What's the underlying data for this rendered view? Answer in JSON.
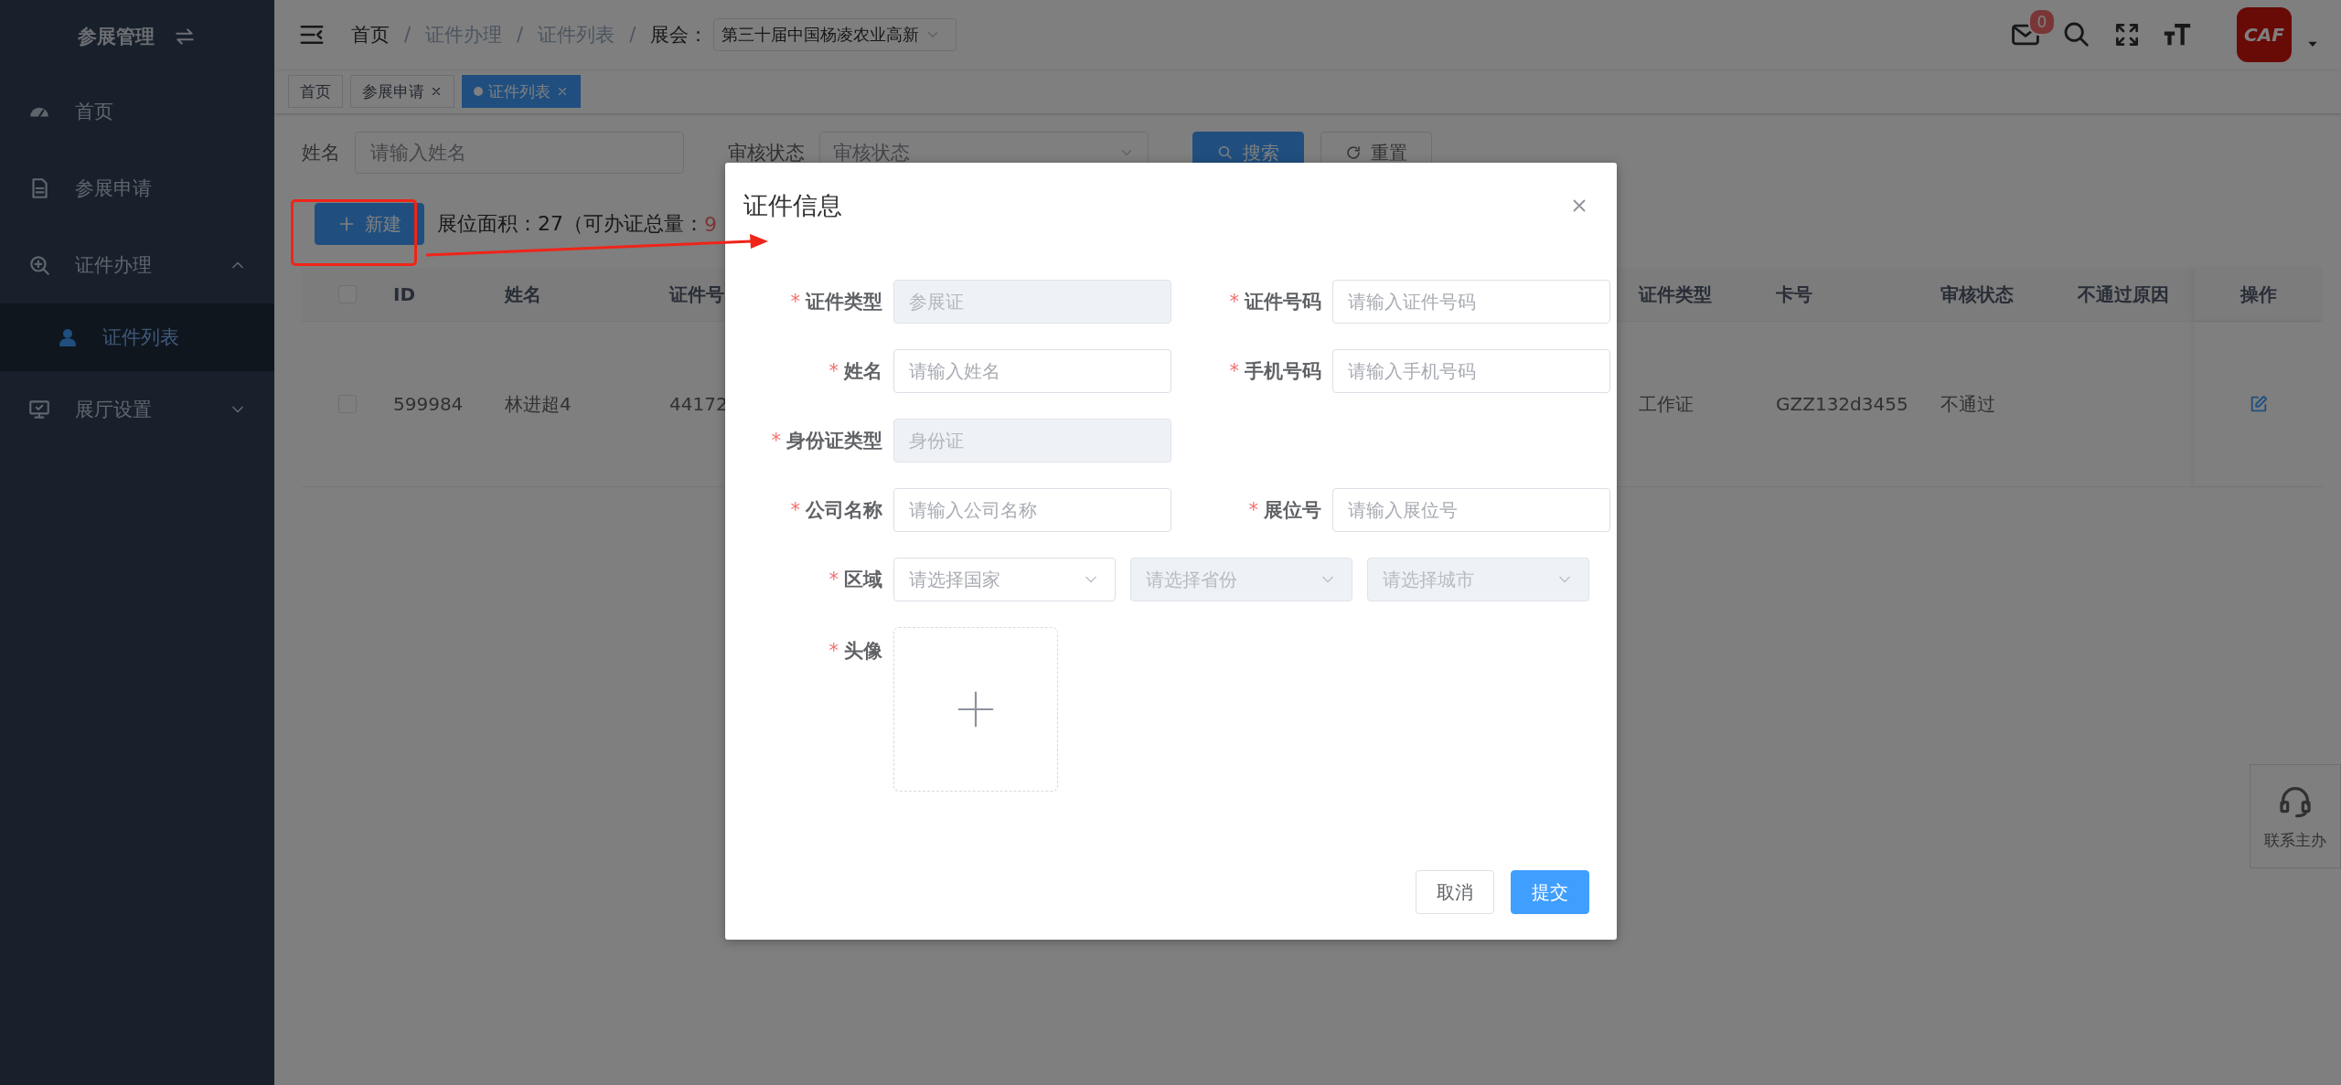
{
  "sidebar": {
    "title": "参展管理",
    "items": [
      {
        "label": "首页",
        "selected": false
      },
      {
        "label": "参展申请",
        "selected": false
      },
      {
        "label": "证件办理",
        "selected": false,
        "expanded": true,
        "children": [
          {
            "label": "证件列表",
            "selected": true
          }
        ]
      },
      {
        "label": "展厅设置",
        "selected": false,
        "expanded": false
      }
    ]
  },
  "header": {
    "breadcrumb": [
      {
        "label": "首页",
        "link": true
      },
      {
        "separator": "/",
        "label": "证件办理",
        "link": false
      },
      {
        "separator": "/",
        "label": "证件列表",
        "link": false
      }
    ],
    "expo_separator": "/",
    "expo_label": "展会：",
    "expo_value": "第三十届中国杨凌农业高新",
    "mail_badge": "0",
    "logo": "CAF"
  },
  "tags": [
    {
      "label": "首页",
      "selected": false,
      "closable": false
    },
    {
      "label": "参展申请",
      "selected": false,
      "closable": true
    },
    {
      "label": "证件列表",
      "selected": true,
      "closable": true
    }
  ],
  "filters": [
    {
      "label": "姓名",
      "kind": "input",
      "placeholder": "请输入姓名"
    },
    {
      "label": "审核状态",
      "kind": "select",
      "placeholder": "审核状态"
    }
  ],
  "filter_buttons": [
    {
      "label": "搜索",
      "kind": "primary"
    },
    {
      "label": "重置",
      "kind": "default"
    }
  ],
  "toolbar": {
    "new_button": "新建",
    "area_text": "展位面积：27（可办证总量：",
    "quota": "9"
  },
  "table": {
    "all_checked": false,
    "columns": [
      "ID",
      "姓名",
      "证件号",
      "证件类型",
      "卡号",
      "审核状态",
      "不通过原因",
      "操作"
    ],
    "rows": [
      {
        "checked": false,
        "cells": [
          "599984",
          "林进超4",
          "44172",
          "工作证",
          "GZZ132d3455",
          "不通过",
          ""
        ]
      }
    ]
  },
  "modal": {
    "title": "证件信息",
    "rows": [
      {
        "fields": [
          {
            "label": "证件类型",
            "required": "*",
            "kind": "input",
            "value": "参展证",
            "disabled": true
          },
          {
            "label": "证件号码",
            "required": "*",
            "kind": "input",
            "placeholder": "请输入证件号码",
            "disabled": false
          }
        ]
      },
      {
        "fields": [
          {
            "label": "姓名",
            "required": "*",
            "kind": "input",
            "placeholder": "请输入姓名",
            "disabled": false
          },
          {
            "label": "手机号码",
            "required": "*",
            "kind": "input",
            "placeholder": "请输入手机号码",
            "disabled": false
          }
        ]
      },
      {
        "fields": [
          {
            "label": "身份证类型",
            "required": "*",
            "kind": "input",
            "value": "身份证",
            "disabled": true
          }
        ]
      },
      {
        "fields": [
          {
            "label": "公司名称",
            "required": "*",
            "kind": "input",
            "placeholder": "请输入公司名称",
            "disabled": false
          },
          {
            "label": "展位号",
            "required": "*",
            "kind": "input",
            "placeholder": "请输入展位号",
            "disabled": false
          }
        ]
      },
      {
        "fields": [
          {
            "label": "区域",
            "required": "*",
            "kind": "selects",
            "selects": [
              {
                "placeholder": "请选择国家",
                "disabled": false
              },
              {
                "placeholder": "请选择省份",
                "disabled": true
              },
              {
                "placeholder": "请选择城市",
                "disabled": true
              }
            ]
          }
        ]
      },
      {
        "fields": [
          {
            "label": "头像",
            "required": "*",
            "kind": "upload"
          }
        ]
      }
    ],
    "buttons": [
      {
        "label": "取消",
        "kind": "default"
      },
      {
        "label": "提交",
        "kind": "primary"
      }
    ]
  },
  "help": {
    "label": "联系主办"
  }
}
